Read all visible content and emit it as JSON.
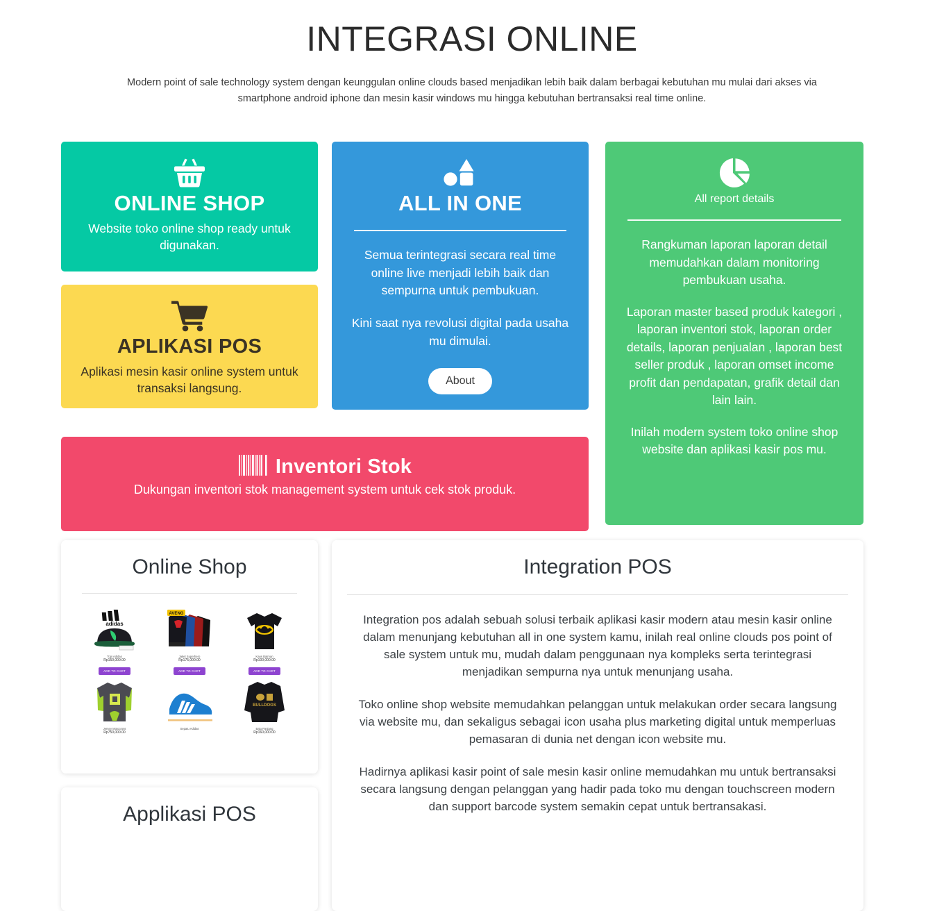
{
  "hero": {
    "title": "INTEGRASI ONLINE",
    "subtitle": "Modern point of sale technology system dengan keunggulan online clouds based menjadikan lebih baik dalam berbagai kebutuhan mu mulai dari akses via smartphone android iphone dan mesin kasir windows mu hingga kebutuhan bertransaksi real time online."
  },
  "cards": {
    "online_shop": {
      "icon": "shopping-basket-icon",
      "title": "ONLINE SHOP",
      "desc": "Website toko online shop ready untuk digunakan.",
      "color": "#05c9a4"
    },
    "aplikasi_pos": {
      "icon": "shopping-cart-icon",
      "title": "APLIKASI POS",
      "desc": "Aplikasi mesin kasir online system untuk transaksi langsung.",
      "color": "#fcd951"
    },
    "all_in_one": {
      "icon": "shapes-icon",
      "title": "ALL IN ONE",
      "para1": "Semua terintegrasi secara real time online live menjadi lebih baik dan sempurna untuk pembukuan.",
      "para2": "Kini saat nya revolusi digital pada usaha mu dimulai.",
      "button": "About",
      "color": "#3498db"
    },
    "report": {
      "icon": "pie-chart-icon",
      "label": "All report details",
      "para1": "Rangkuman laporan laporan detail memudahkan dalam monitoring pembukuan usaha.",
      "para2": "Laporan master based produk kategori , laporan inventori stok, laporan order details, laporan penjualan , laporan best seller produk , laporan omset income profit dan pendapatan, grafik detail dan lain lain.",
      "para3": "Inilah modern system toko online shop website dan aplikasi kasir pos mu.",
      "color": "#4ec977"
    },
    "inventori": {
      "icon": "barcode-icon",
      "title": "Inventori Stok",
      "desc": "Dukungan inventori stok management system untuk cek stok produk.",
      "color": "#f2496b"
    }
  },
  "panels": {
    "online_shop": {
      "title": "Online Shop",
      "products": [
        {
          "name": "Topi Adidas",
          "price": "Rp150,000.00",
          "button": "ADD TO CART",
          "image": "adidas-cap-image"
        },
        {
          "name": "Jaket Superhero",
          "price": "Rp175,000.00",
          "button": "ADD TO CART",
          "image": "superhero-jackets-image"
        },
        {
          "name": "Kaos Batman",
          "price": "Rp100,000.00",
          "button": "ADD TO CART",
          "image": "batman-tshirt-image"
        },
        {
          "name": "Jersey Motocross",
          "price": "Rp750,000.00",
          "button": "",
          "image": "motocross-jersey-image"
        },
        {
          "name": "Sepatu Adidas",
          "price": "",
          "button": "",
          "image": "adidas-sneaker-image"
        },
        {
          "name": "Baju Panjang",
          "price": "Rp160,000.00",
          "button": "",
          "image": "black-longsleeve-image"
        }
      ]
    },
    "aplikasi_pos": {
      "title": "Applikasi POS"
    },
    "integration_pos": {
      "title": "Integration POS",
      "para1": "Integration pos adalah sebuah solusi terbaik aplikasi kasir modern atau mesin kasir online dalam menunjang kebutuhan all in one system kamu, inilah real online clouds pos point of sale system untuk mu, mudah dalam penggunaan nya kompleks serta terintegrasi menjadikan sempurna nya untuk menunjang usaha.",
      "para2": "Toko online shop website memudahkan pelanggan untuk melakukan order secara langsung via website mu, dan sekaligus sebagai icon usaha plus marketing digital untuk memperluas pemasaran di dunia net dengan icon website mu.",
      "para3": "Hadirnya aplikasi kasir point of sale mesin kasir online memudahkan mu untuk bertransaksi secara langsung dengan pelanggan yang hadir pada toko mu dengan touchscreen modern dan support barcode system semakin cepat untuk bertransakasi."
    }
  }
}
